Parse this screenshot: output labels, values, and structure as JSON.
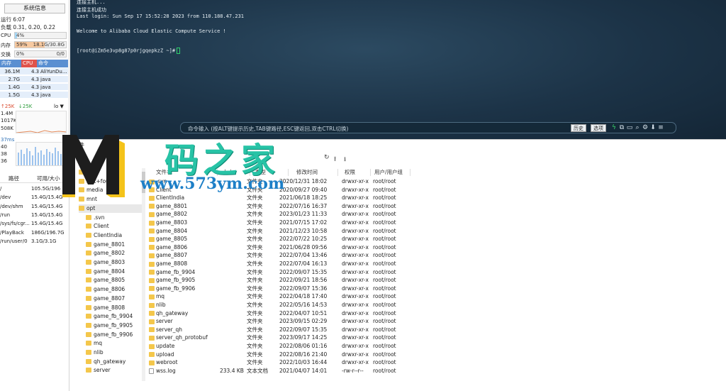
{
  "left_panel": {
    "sys_button": "系统信息",
    "uptime": "运行 6:07",
    "load": "负载 0.31, 0.20, 0.22",
    "cpu": {
      "label": "CPU",
      "pct": "4%",
      "fill": 0.04,
      "color": "#a6d7f5"
    },
    "mem": {
      "label": "内存",
      "pct": "59%",
      "amount": "18.1G/30.8G",
      "fill": 0.59,
      "color": "#f7c9a0"
    },
    "swap": {
      "label": "交换",
      "pct": "0%",
      "amount": "0/0",
      "fill": 0.0,
      "color": "#a6d7f5"
    },
    "proc_headers": [
      "内存",
      "CPU",
      "命令"
    ],
    "processes": [
      {
        "mem": "36.1M",
        "cpu": "4.3",
        "cmd": "AliYunDu..."
      },
      {
        "mem": "2.7G",
        "cpu": "4.3",
        "cmd": "java"
      },
      {
        "mem": "1.4G",
        "cpu": "4.3",
        "cmd": "java"
      },
      {
        "mem": "1.5G",
        "cpu": "4.3",
        "cmd": "java"
      }
    ],
    "net": {
      "up": "↑25K",
      "down": "↓25K",
      "iface": "lo",
      "levels": [
        "1.4M",
        "1017K",
        "508K"
      ]
    },
    "latency": {
      "value": "37ms",
      "levels": [
        "40",
        "38",
        "36"
      ]
    },
    "disk_headers": [
      "路径",
      "可用/大小"
    ],
    "disks": [
      {
        "path": "/",
        "size": "105.5G/196"
      },
      {
        "path": "/dev",
        "size": "15.4G/15.4G"
      },
      {
        "path": "/dev/shm",
        "size": "15.4G/15.4G"
      },
      {
        "path": "/run",
        "size": "15.4G/15.4G"
      },
      {
        "path": "/sys/fs/cgr...",
        "size": "15.4G/15.4G"
      },
      {
        "path": "/PlayBack",
        "size": "186G/196.7G"
      },
      {
        "path": "/run/user/0",
        "size": "3.1G/3.1G"
      }
    ]
  },
  "terminal": {
    "lines": [
      "连接主机...",
      "连接主机成功",
      "Last login: Sun Sep 17 15:52:28 2023 from 110.188.47.231",
      "",
      "Welcome to Alibaba Cloud Elastic Compute Service !",
      "",
      "[root@iZm5e3vp8g87p0rjgqepkzZ ~]#"
    ],
    "cmd_hint": "命令输入 (按ALT键提示历史,TAB键路径,ESC键返回,双击CTRL切换)",
    "history_btn": "历史",
    "options_btn": "选项"
  },
  "file_manager": {
    "tab": "文件",
    "columns": [
      "文件名",
      "大小",
      "类型",
      "修改时间",
      "权限",
      "用户/用户组"
    ],
    "tree": [
      {
        "name": "lib",
        "depth": 0
      },
      {
        "name": "lost+found",
        "depth": 0
      },
      {
        "name": "media",
        "depth": 0
      },
      {
        "name": "mnt",
        "depth": 0
      },
      {
        "name": "opt",
        "depth": 0,
        "selected": true
      },
      {
        "name": ".svn",
        "depth": 1
      },
      {
        "name": "Client",
        "depth": 1
      },
      {
        "name": "ClientIndia",
        "depth": 1
      },
      {
        "name": "game_8801",
        "depth": 1
      },
      {
        "name": "game_8802",
        "depth": 1
      },
      {
        "name": "game_8803",
        "depth": 1
      },
      {
        "name": "game_8804",
        "depth": 1
      },
      {
        "name": "game_8805",
        "depth": 1
      },
      {
        "name": "game_8806",
        "depth": 1
      },
      {
        "name": "game_8807",
        "depth": 1
      },
      {
        "name": "game_8808",
        "depth": 1
      },
      {
        "name": "game_fb_9904",
        "depth": 1
      },
      {
        "name": "game_fb_9905",
        "depth": 1
      },
      {
        "name": "game_fb_9906",
        "depth": 1
      },
      {
        "name": "mq",
        "depth": 1
      },
      {
        "name": "nlib",
        "depth": 1
      },
      {
        "name": "qh_gateway",
        "depth": 1
      },
      {
        "name": "server",
        "depth": 1
      }
    ],
    "files": [
      {
        "name": ".svn",
        "size": "",
        "type": "文件夹",
        "mtime": "2020/12/31 18:02",
        "perm": "drwxr-xr-x",
        "owner": "root/root"
      },
      {
        "name": "Client",
        "size": "",
        "type": "文件夹",
        "mtime": "2020/09/27 09:40",
        "perm": "drwxr-xr-x",
        "owner": "root/root"
      },
      {
        "name": "ClientIndia",
        "size": "",
        "type": "文件夹",
        "mtime": "2021/06/18 18:25",
        "perm": "drwxr-xr-x",
        "owner": "root/root"
      },
      {
        "name": "game_8801",
        "size": "",
        "type": "文件夹",
        "mtime": "2022/07/16 16:37",
        "perm": "drwxr-xr-x",
        "owner": "root/root"
      },
      {
        "name": "game_8802",
        "size": "",
        "type": "文件夹",
        "mtime": "2023/01/23 11:33",
        "perm": "drwxr-xr-x",
        "owner": "root/root"
      },
      {
        "name": "game_8803",
        "size": "",
        "type": "文件夹",
        "mtime": "2021/07/15 17:02",
        "perm": "drwxr-xr-x",
        "owner": "root/root"
      },
      {
        "name": "game_8804",
        "size": "",
        "type": "文件夹",
        "mtime": "2021/12/23 10:58",
        "perm": "drwxr-xr-x",
        "owner": "root/root"
      },
      {
        "name": "game_8805",
        "size": "",
        "type": "文件夹",
        "mtime": "2022/07/22 10:25",
        "perm": "drwxr-xr-x",
        "owner": "root/root"
      },
      {
        "name": "game_8806",
        "size": "",
        "type": "文件夹",
        "mtime": "2021/06/28 09:56",
        "perm": "drwxr-xr-x",
        "owner": "root/root"
      },
      {
        "name": "game_8807",
        "size": "",
        "type": "文件夹",
        "mtime": "2022/07/04 13:46",
        "perm": "drwxr-xr-x",
        "owner": "root/root"
      },
      {
        "name": "game_8808",
        "size": "",
        "type": "文件夹",
        "mtime": "2022/07/04 16:13",
        "perm": "drwxr-xr-x",
        "owner": "root/root"
      },
      {
        "name": "game_fb_9904",
        "size": "",
        "type": "文件夹",
        "mtime": "2022/09/07 15:35",
        "perm": "drwxr-xr-x",
        "owner": "root/root"
      },
      {
        "name": "game_fb_9905",
        "size": "",
        "type": "文件夹",
        "mtime": "2022/09/21 18:56",
        "perm": "drwxr-xr-x",
        "owner": "root/root"
      },
      {
        "name": "game_fb_9906",
        "size": "",
        "type": "文件夹",
        "mtime": "2022/09/07 15:36",
        "perm": "drwxr-xr-x",
        "owner": "root/root"
      },
      {
        "name": "mq",
        "size": "",
        "type": "文件夹",
        "mtime": "2022/04/18 17:40",
        "perm": "drwxr-xr-x",
        "owner": "root/root"
      },
      {
        "name": "nlib",
        "size": "",
        "type": "文件夹",
        "mtime": "2022/05/16 14:53",
        "perm": "drwxr-xr-x",
        "owner": "root/root"
      },
      {
        "name": "qh_gateway",
        "size": "",
        "type": "文件夹",
        "mtime": "2022/04/07 10:51",
        "perm": "drwxr-xr-x",
        "owner": "root/root"
      },
      {
        "name": "server",
        "size": "",
        "type": "文件夹",
        "mtime": "2023/09/15 02:29",
        "perm": "drwxr-xr-x",
        "owner": "root/root"
      },
      {
        "name": "server_qh",
        "size": "",
        "type": "文件夹",
        "mtime": "2022/09/07 15:35",
        "perm": "drwxr-xr-x",
        "owner": "root/root"
      },
      {
        "name": "server_qh_protobuf",
        "size": "",
        "type": "文件夹",
        "mtime": "2023/09/17 14:25",
        "perm": "drwxr-xr-x",
        "owner": "root/root"
      },
      {
        "name": "update",
        "size": "",
        "type": "文件夹",
        "mtime": "2022/08/06 01:16",
        "perm": "drwxr-xr-x",
        "owner": "root/root"
      },
      {
        "name": "upload",
        "size": "",
        "type": "文件夹",
        "mtime": "2022/08/16 21:40",
        "perm": "drwxr-xr-x",
        "owner": "root/root"
      },
      {
        "name": "webroot",
        "size": "",
        "type": "文件夹",
        "mtime": "2022/10/03 16:44",
        "perm": "drwxr-xr-x",
        "owner": "root/root"
      },
      {
        "name": "wss.log",
        "size": "233.4 KB",
        "type": "文本文档",
        "mtime": "2021/04/07 14:01",
        "perm": "-rw-r--r--",
        "owner": "root/root",
        "is_file": true
      }
    ]
  },
  "watermark": {
    "zh": "码之家",
    "url": "www.573ym.com"
  }
}
